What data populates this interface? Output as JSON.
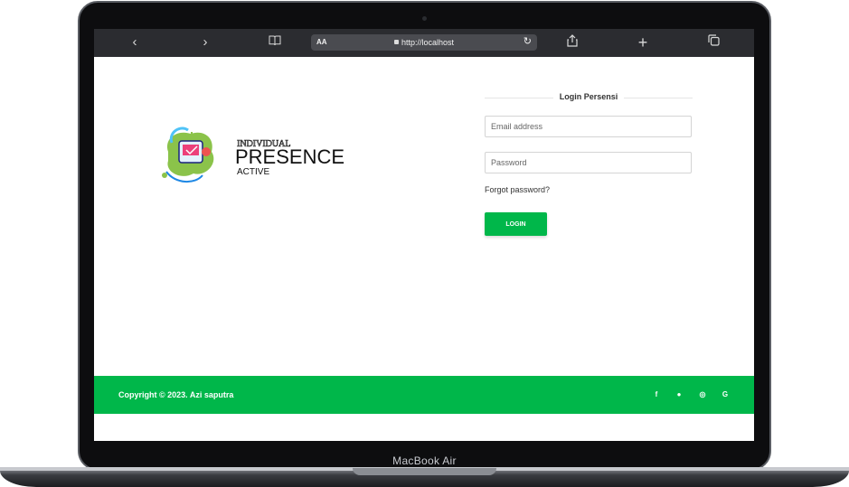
{
  "device": {
    "brand": "MacBook Air"
  },
  "browser": {
    "back_icon": "chevron-left-icon",
    "forward_icon": "chevron-right-icon",
    "reader_label": "AA",
    "url": "http://localhost",
    "nav": {
      "back": "‹",
      "forward": "›",
      "bookmarks": "🕮",
      "share": "⇪",
      "new_tab": "+",
      "tabs": "⧉",
      "reload": "↻"
    }
  },
  "logo": {
    "line1": "INDIVIDUAL",
    "line2": "PRESENCE",
    "line3": "ACTIVE"
  },
  "login": {
    "title": "Login Persensi",
    "email_placeholder": "Email address",
    "password_placeholder": "Password",
    "forgot": "Forgot password?",
    "button": "LOGIN"
  },
  "footer": {
    "copyright": "Copyright © 2023. Azi saputra",
    "social": [
      {
        "name": "facebook-icon",
        "glyph": "f"
      },
      {
        "name": "github-icon",
        "glyph": "●"
      },
      {
        "name": "whatsapp-icon",
        "glyph": "◎"
      },
      {
        "name": "google-icon",
        "glyph": "G"
      }
    ]
  },
  "colors": {
    "accent": "#00b74a",
    "toolbar": "#2b2c30"
  }
}
